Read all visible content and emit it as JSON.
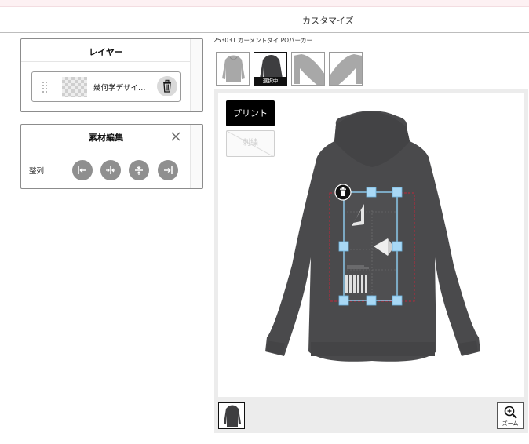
{
  "header": {
    "title": "カスタマイズ"
  },
  "layer_panel": {
    "title": "レイヤー",
    "items": [
      {
        "name": "幾何学デザイ…"
      }
    ]
  },
  "material_panel": {
    "title": "素材編集",
    "align_label": "整列",
    "align_buttons": [
      "align-left",
      "align-center-horizontal",
      "align-center-vertical",
      "align-right"
    ]
  },
  "product": {
    "name": "253031 ガーメントダイ POパーカー",
    "views": [
      {
        "view": "front",
        "selected": false
      },
      {
        "view": "back",
        "selected": true,
        "badge": "選択中"
      },
      {
        "view": "right-sleeve",
        "selected": false
      },
      {
        "view": "left-sleeve",
        "selected": false
      }
    ]
  },
  "canvas": {
    "print_button": "プリント",
    "embroidery_button": "刺繍",
    "garment_color": "#4a4a4c",
    "handle_color": "#a8d8f5"
  },
  "zoom": {
    "label": "ズーム"
  }
}
